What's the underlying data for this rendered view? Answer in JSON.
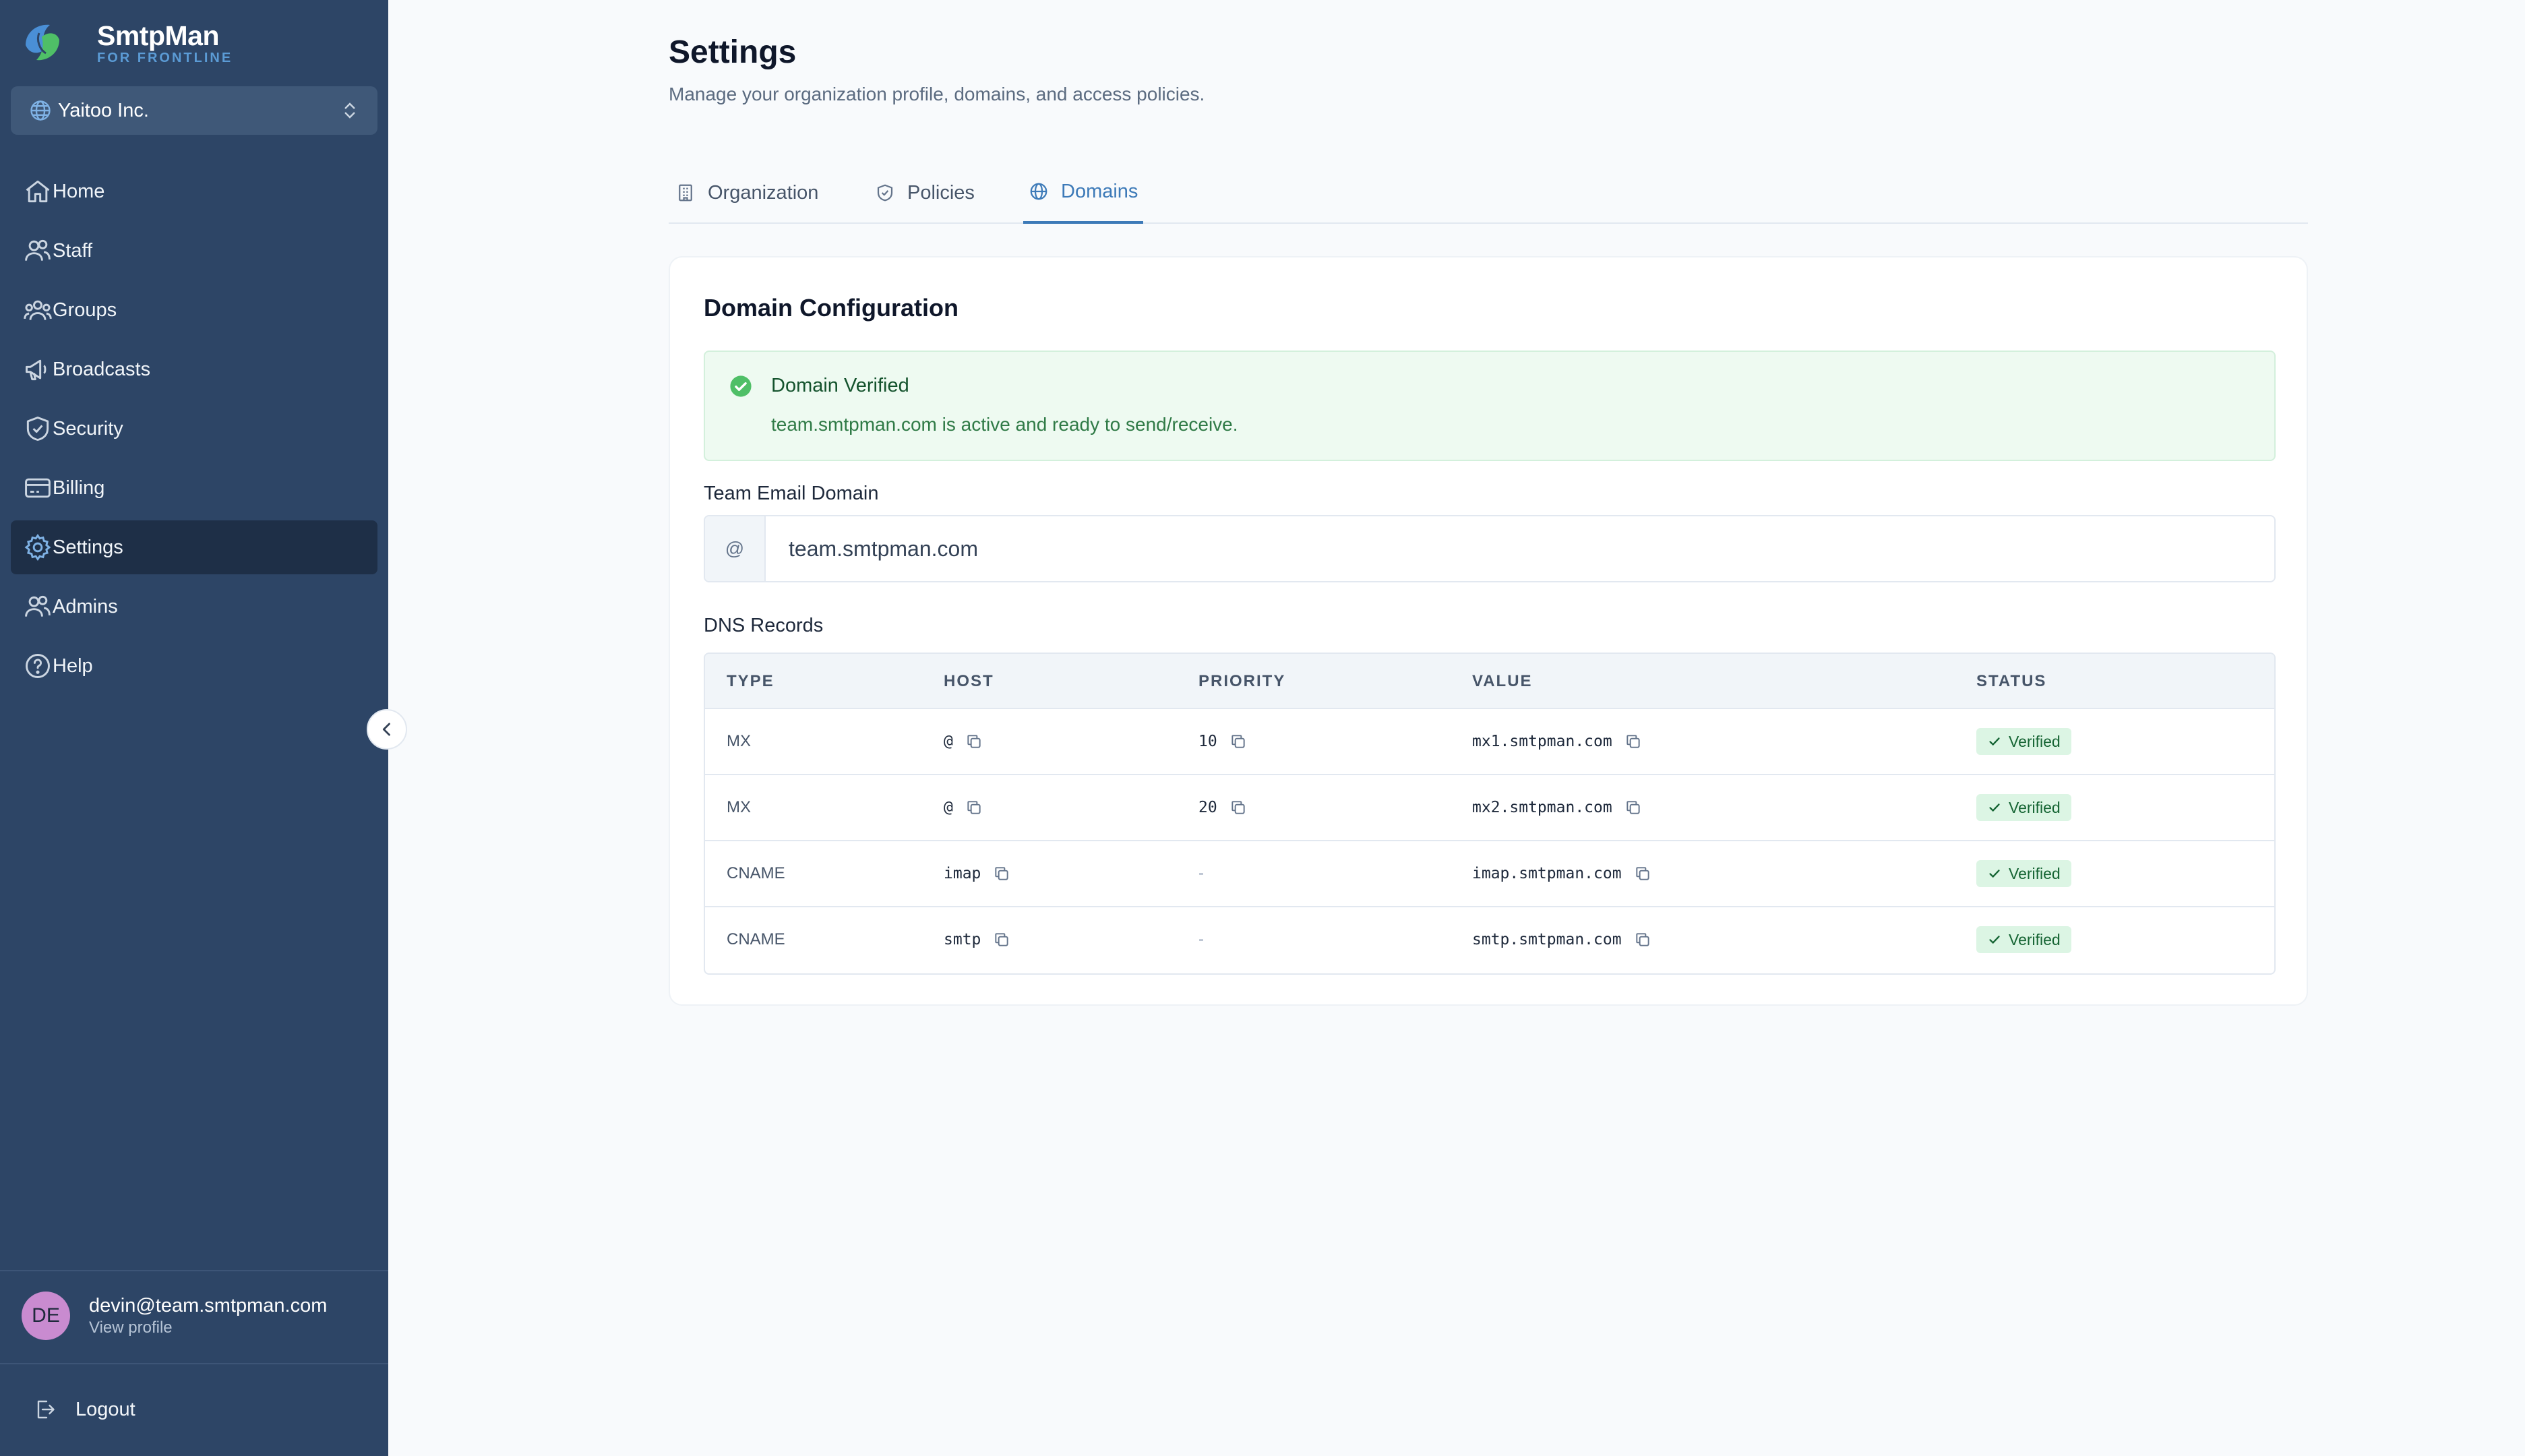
{
  "app": {
    "name": "SmtpMan",
    "tagline": "FOR FRONTLINE"
  },
  "org": {
    "name": "Yaitoo Inc."
  },
  "nav": {
    "items": [
      {
        "label": "Home",
        "icon": "home-icon"
      },
      {
        "label": "Staff",
        "icon": "users-icon"
      },
      {
        "label": "Groups",
        "icon": "groups-icon"
      },
      {
        "label": "Broadcasts",
        "icon": "megaphone-icon"
      },
      {
        "label": "Security",
        "icon": "shield-check-icon"
      },
      {
        "label": "Billing",
        "icon": "billing-icon"
      },
      {
        "label": "Settings",
        "icon": "gear-icon",
        "active": true
      },
      {
        "label": "Admins",
        "icon": "admins-icon"
      },
      {
        "label": "Help",
        "icon": "help-icon"
      }
    ]
  },
  "user": {
    "email": "devin@team.smtpman.com",
    "initials": "DE",
    "profile_link": "View profile"
  },
  "logout_label": "Logout",
  "page": {
    "title": "Settings",
    "subtitle": "Manage your organization profile, domains, and access policies."
  },
  "tabs": [
    {
      "label": "Organization",
      "icon": "building-icon"
    },
    {
      "label": "Policies",
      "icon": "shield-icon"
    },
    {
      "label": "Domains",
      "icon": "globe-icon",
      "active": true
    }
  ],
  "domain_card": {
    "title": "Domain Configuration",
    "alert": {
      "title": "Domain Verified",
      "message": "team.smtpman.com is active and ready to send/receive."
    },
    "field_label": "Team Email Domain",
    "input_prefix": "@",
    "input_value": "team.smtpman.com",
    "dns_label": "DNS Records"
  },
  "dns": {
    "headers": [
      "TYPE",
      "HOST",
      "PRIORITY",
      "VALUE",
      "STATUS"
    ],
    "rows": [
      {
        "type": "MX",
        "host": "@",
        "priority": "10",
        "value": "mx1.smtpman.com",
        "status": "Verified"
      },
      {
        "type": "MX",
        "host": "@",
        "priority": "20",
        "value": "mx2.smtpman.com",
        "status": "Verified"
      },
      {
        "type": "CNAME",
        "host": "imap",
        "priority": "-",
        "value": "imap.smtpman.com",
        "status": "Verified"
      },
      {
        "type": "CNAME",
        "host": "smtp",
        "priority": "-",
        "value": "smtp.smtpman.com",
        "status": "Verified"
      }
    ]
  },
  "colors": {
    "sidebar": "#2d4566",
    "accent": "#3d7ab8",
    "success": "#22c55e",
    "avatar": "#c98bd0"
  }
}
